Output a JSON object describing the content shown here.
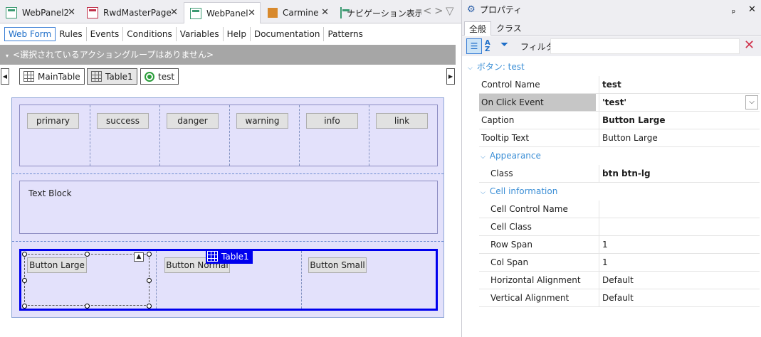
{
  "tabs": [
    {
      "label": "WebPanel2",
      "icon": "webpanel-icon",
      "active": false
    },
    {
      "label": "RwdMasterPage",
      "icon": "masterpage-icon",
      "active": false
    },
    {
      "label": "WebPanel",
      "icon": "webpanel-icon",
      "active": true
    },
    {
      "label": "Carmine",
      "icon": "theme-icon",
      "active": false
    },
    {
      "label": "ナビゲーション表示",
      "icon": "navigation-icon",
      "active": false
    }
  ],
  "menu": [
    "Web Form",
    "Rules",
    "Events",
    "Conditions",
    "Variables",
    "Help",
    "Documentation",
    "Patterns"
  ],
  "action_bar": "<選択されているアクショングループはありません>",
  "breadcrumb": [
    "MainTable",
    "Table1",
    "test"
  ],
  "canvas": {
    "buttons_row": [
      "primary",
      "success",
      "danger",
      "warning",
      "info",
      "link"
    ],
    "text_block": "Text Block",
    "table_label": "Table1",
    "bottom_buttons": [
      "Button Large",
      "Button Normal",
      "Button Small"
    ]
  },
  "props": {
    "title": "プロパティ",
    "pin": "ₚ",
    "close": "✕",
    "tabs": [
      "全般",
      "クラス"
    ],
    "filter_label": "フィルタ",
    "section": "ボタン: test",
    "rows": [
      {
        "k": "Control Name",
        "v": "test",
        "bold": true
      },
      {
        "k": "On Click Event",
        "v": "'test'",
        "bold": true,
        "highlight": true,
        "dropdown": true
      },
      {
        "k": "Caption",
        "v": "Button Large",
        "bold": true
      },
      {
        "k": "Tooltip Text",
        "v": "Button Large",
        "bold": false
      }
    ],
    "appearance_label": "Appearance",
    "appearance_rows": [
      {
        "k": "Class",
        "v": "btn btn-lg",
        "bold": true
      }
    ],
    "cell_label": "Cell information",
    "cell_rows": [
      {
        "k": "Cell Control Name",
        "v": ""
      },
      {
        "k": "Cell Class",
        "v": ""
      },
      {
        "k": "Row Span",
        "v": "1"
      },
      {
        "k": "Col Span",
        "v": "1"
      },
      {
        "k": "Horizontal Alignment",
        "v": "Default"
      },
      {
        "k": "Vertical Alignment",
        "v": "Default"
      }
    ]
  },
  "colors": {
    "accent": "#1e6ec8",
    "selection": "#0000ee",
    "canvas": "#e3e1fb",
    "category": "#3c8fd6"
  }
}
